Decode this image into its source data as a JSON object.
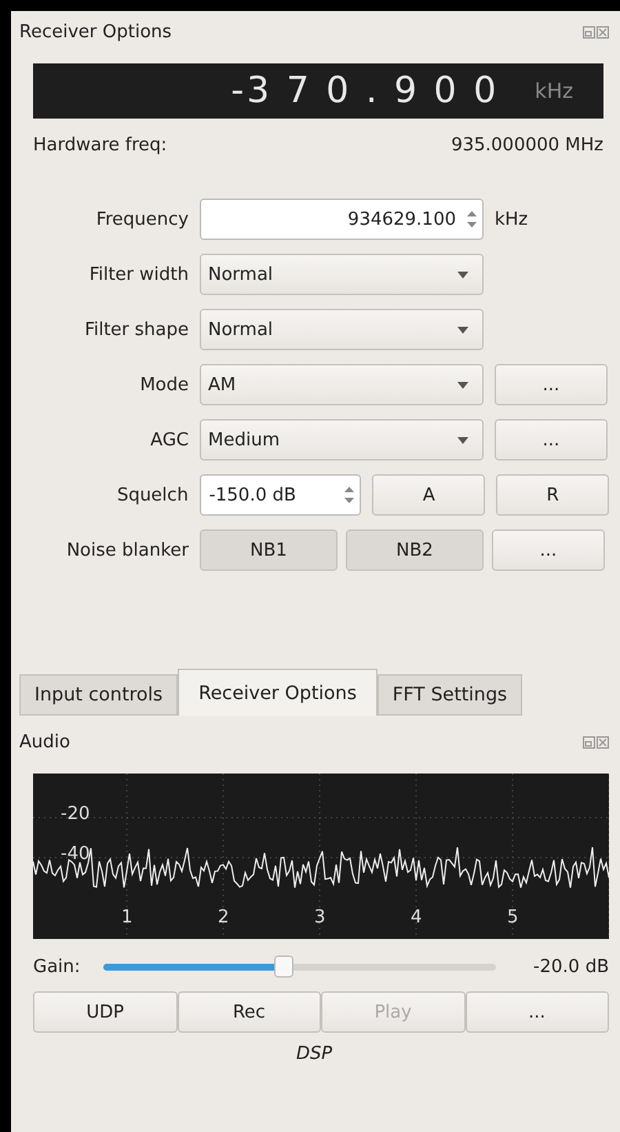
{
  "receiver_panel": {
    "title": "Receiver Options",
    "display": {
      "value": "-3 7 0 . 9 0 0",
      "unit": "kHz"
    },
    "hardware": {
      "label": "Hardware freq:",
      "value": "935.000000 MHz"
    },
    "rows": [
      {
        "kind": "spin-unit",
        "label": "Frequency",
        "value": "934629.100",
        "unit": "kHz"
      },
      {
        "kind": "combo",
        "label": "Filter width",
        "value": "Normal"
      },
      {
        "kind": "combo",
        "label": "Filter shape",
        "value": "Normal"
      },
      {
        "kind": "combo-more",
        "label": "Mode",
        "value": "AM",
        "more": "..."
      },
      {
        "kind": "combo-more",
        "label": "AGC",
        "value": "Medium",
        "more": "..."
      },
      {
        "kind": "squelch",
        "label": "Squelch",
        "value": "-150.0 dB",
        "buttons": [
          "A",
          "R"
        ]
      },
      {
        "kind": "toggles",
        "label": "Noise blanker",
        "buttons": [
          "NB1",
          "NB2"
        ],
        "more": "..."
      }
    ]
  },
  "tabs": [
    {
      "label": "Input controls",
      "selected": false
    },
    {
      "label": "Receiver Options",
      "selected": true
    },
    {
      "label": "FFT Settings",
      "selected": false
    }
  ],
  "audio_panel": {
    "title": "Audio",
    "spectrum": {
      "y_labels": [
        "-20",
        "-40"
      ],
      "x_labels": [
        "1",
        "2",
        "3",
        "4",
        "5"
      ]
    },
    "gain": {
      "label": "Gain:",
      "level": 0.46,
      "reading": "-20.0 dB"
    },
    "buttons": [
      {
        "label": "UDP",
        "disabled": false
      },
      {
        "label": "Rec",
        "disabled": false
      },
      {
        "label": "Play",
        "disabled": true
      },
      {
        "label": "...",
        "disabled": false
      }
    ],
    "dsp_label": "DSP"
  }
}
